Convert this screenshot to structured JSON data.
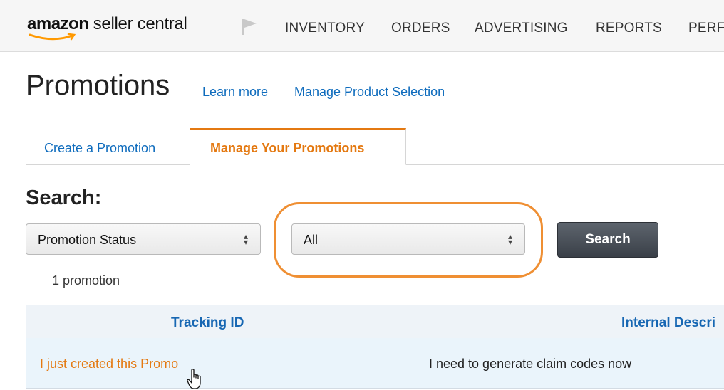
{
  "logo": {
    "brand": "amazon",
    "rest": " seller central"
  },
  "nav": {
    "items": [
      "INVENTORY",
      "ORDERS",
      "ADVERTISING",
      "REPORTS",
      "PERF"
    ]
  },
  "header": {
    "title": "Promotions",
    "learn_more": "Learn more",
    "manage_product_selection": "Manage Product Selection"
  },
  "tabs": {
    "create": "Create a Promotion",
    "manage": "Manage Your Promotions"
  },
  "search": {
    "heading": "Search:",
    "field_select": "Promotion Status",
    "value_select": "All",
    "button": "Search",
    "count": "1 promotion"
  },
  "table": {
    "headers": [
      "Tracking ID",
      "Internal Descri"
    ],
    "rows": [
      {
        "tracking_id": "I just created this Promo",
        "description": "I need to generate claim codes now"
      }
    ]
  },
  "colors": {
    "accent": "#e47911",
    "link": "#0f6cbd",
    "highlight": "#ef8f33"
  }
}
